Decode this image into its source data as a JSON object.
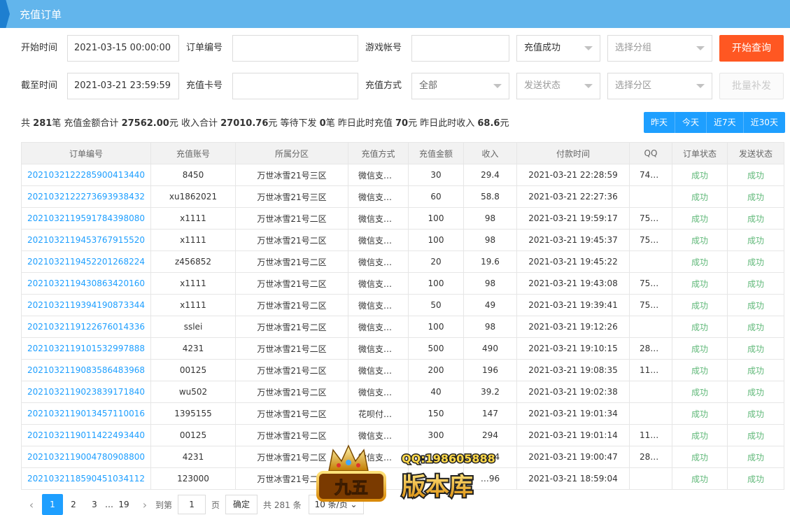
{
  "header": {
    "title": "充值订单"
  },
  "filters": {
    "start_label": "开始时间",
    "start_value": "2021-03-15 00:00:00",
    "end_label": "截至时间",
    "end_value": "2021-03-21 23:59:59",
    "order_no_label": "订单编号",
    "order_no_value": "",
    "card_no_label": "充值卡号",
    "card_no_value": "",
    "account_label": "游戏帐号",
    "account_value": "",
    "method_label": "充值方式",
    "method_value": "全部",
    "status_value": "充值成功",
    "send_status_placeholder": "发送状态",
    "group_placeholder": "选择分组",
    "zone_placeholder": "选择分区",
    "query_button": "开始查询",
    "batch_button": "批量补发"
  },
  "summary": {
    "p1": "共",
    "total_count": "281",
    "p2": "笔 充值金额合计",
    "total_amount": "27562.00",
    "p3": "元 收入合计",
    "total_income": "27010.76",
    "p4": "元 等待下发",
    "pending": "0",
    "p5": "笔 昨日此时充值",
    "yesterday_recharge": "70",
    "p6": "元 昨日此时收入",
    "yesterday_income": "68.6",
    "p7": "元"
  },
  "date_buttons": [
    "昨天",
    "今天",
    "近7天",
    "近30天"
  ],
  "table": {
    "columns": [
      "订单编号",
      "充值账号",
      "所属分区",
      "充值方式",
      "充值金额",
      "收入",
      "付款时间",
      "QQ",
      "订单状态",
      "发送状态"
    ],
    "rows": [
      [
        "2021032122285900413440",
        "8450",
        "万世冰雪21号三区",
        "微信支…",
        "30",
        "29.4",
        "2021-03-21 22:28:59",
        "74…",
        "成功",
        "成功"
      ],
      [
        "2021032122273693938432",
        "xu1862021",
        "万世冰雪21号三区",
        "微信支…",
        "60",
        "58.8",
        "2021-03-21 22:27:36",
        "",
        "成功",
        "成功"
      ],
      [
        "2021032119591784398080",
        "x1111",
        "万世冰雪21号二区",
        "微信支…",
        "100",
        "98",
        "2021-03-21 19:59:17",
        "75…",
        "成功",
        "成功"
      ],
      [
        "2021032119453767915520",
        "x1111",
        "万世冰雪21号二区",
        "微信支…",
        "100",
        "98",
        "2021-03-21 19:45:37",
        "75…",
        "成功",
        "成功"
      ],
      [
        "2021032119452201268224",
        "z456852",
        "万世冰雪21号二区",
        "微信支…",
        "20",
        "19.6",
        "2021-03-21 19:45:22",
        "",
        "成功",
        "成功"
      ],
      [
        "2021032119430863420160",
        "x1111",
        "万世冰雪21号二区",
        "微信支…",
        "100",
        "98",
        "2021-03-21 19:43:08",
        "75…",
        "成功",
        "成功"
      ],
      [
        "2021032119394190873344",
        "x1111",
        "万世冰雪21号二区",
        "微信支…",
        "50",
        "49",
        "2021-03-21 19:39:41",
        "75…",
        "成功",
        "成功"
      ],
      [
        "2021032119122676014336",
        "sslei",
        "万世冰雪21号二区",
        "微信支…",
        "100",
        "98",
        "2021-03-21 19:12:26",
        "",
        "成功",
        "成功"
      ],
      [
        "2021032119101532997888",
        "4231",
        "万世冰雪21号二区",
        "微信支…",
        "500",
        "490",
        "2021-03-21 19:10:15",
        "28…",
        "成功",
        "成功"
      ],
      [
        "2021032119083586483968",
        "00125",
        "万世冰雪21号二区",
        "微信支…",
        "200",
        "196",
        "2021-03-21 19:08:35",
        "11…",
        "成功",
        "成功"
      ],
      [
        "2021032119023839171840",
        "wu502",
        "万世冰雪21号二区",
        "微信支…",
        "40",
        "39.2",
        "2021-03-21 19:02:38",
        "",
        "成功",
        "成功"
      ],
      [
        "2021032119013457110016",
        "1395155",
        "万世冰雪21号二区",
        "花呗付…",
        "150",
        "147",
        "2021-03-21 19:01:34",
        "",
        "成功",
        "成功"
      ],
      [
        "2021032119011422493440",
        "00125",
        "万世冰雪21号二区",
        "微信支…",
        "300",
        "294",
        "2021-03-21 19:01:14",
        "11…",
        "成功",
        "成功"
      ],
      [
        "2021032119004780908800",
        "4231",
        "万世冰雪21号二区",
        "微信支…",
        "",
        "…94",
        "2021-03-21 19:00:47",
        "28…",
        "成功",
        "成功"
      ],
      [
        "2021032118590451034112",
        "123000",
        "万世冰雪21号二区",
        "",
        "",
        "…96",
        "2021-03-21 18:59:04",
        "",
        "成功",
        "成功"
      ]
    ]
  },
  "pager": {
    "pages": [
      "1",
      "2",
      "3"
    ],
    "ellipsis": "…",
    "last": "19",
    "goto_label": "到第",
    "goto_value": "1",
    "page_unit": "页",
    "confirm": "确定",
    "total": "共 281 条",
    "page_size": "10 条/页"
  },
  "watermark": {
    "qq": "QQ:198605888",
    "badge": "九五",
    "brand": "版本库"
  },
  "colors": {
    "header": "#62b5ec",
    "query_button": "#ff5722",
    "date_buttons": "#1e9fff",
    "link": "#1e9fff",
    "success": "#5fb878"
  }
}
